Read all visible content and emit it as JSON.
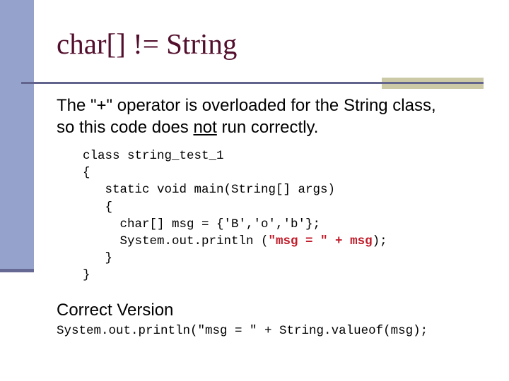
{
  "slide": {
    "title": "char[] != String",
    "body": {
      "line1": "The \"+\" operator is overloaded for the String class,",
      "line2_before": "so this code does ",
      "line2_underlined": "not",
      "line2_after": " run correctly."
    },
    "code_block": {
      "lines": [
        "class string_test_1",
        "{",
        "   static void main(String[] args)",
        "   {",
        "     char[] msg = {'B','o','b'};",
        "     System.out.println (",
        "   }",
        "}"
      ],
      "highlight_text": "\"msg = \" + msg",
      "after_highlight": ");"
    },
    "correct_version": {
      "heading": "Correct Version",
      "code": "System.out.println(\"msg = \" + String.valueof(msg);"
    }
  },
  "colors": {
    "sidebar": "#95a3cc",
    "sidebar_band": "#676995",
    "title": "#520e2c",
    "rule": "#62648e",
    "rule_accent": "#ccc9a6",
    "code_highlight": "#c01a28"
  }
}
